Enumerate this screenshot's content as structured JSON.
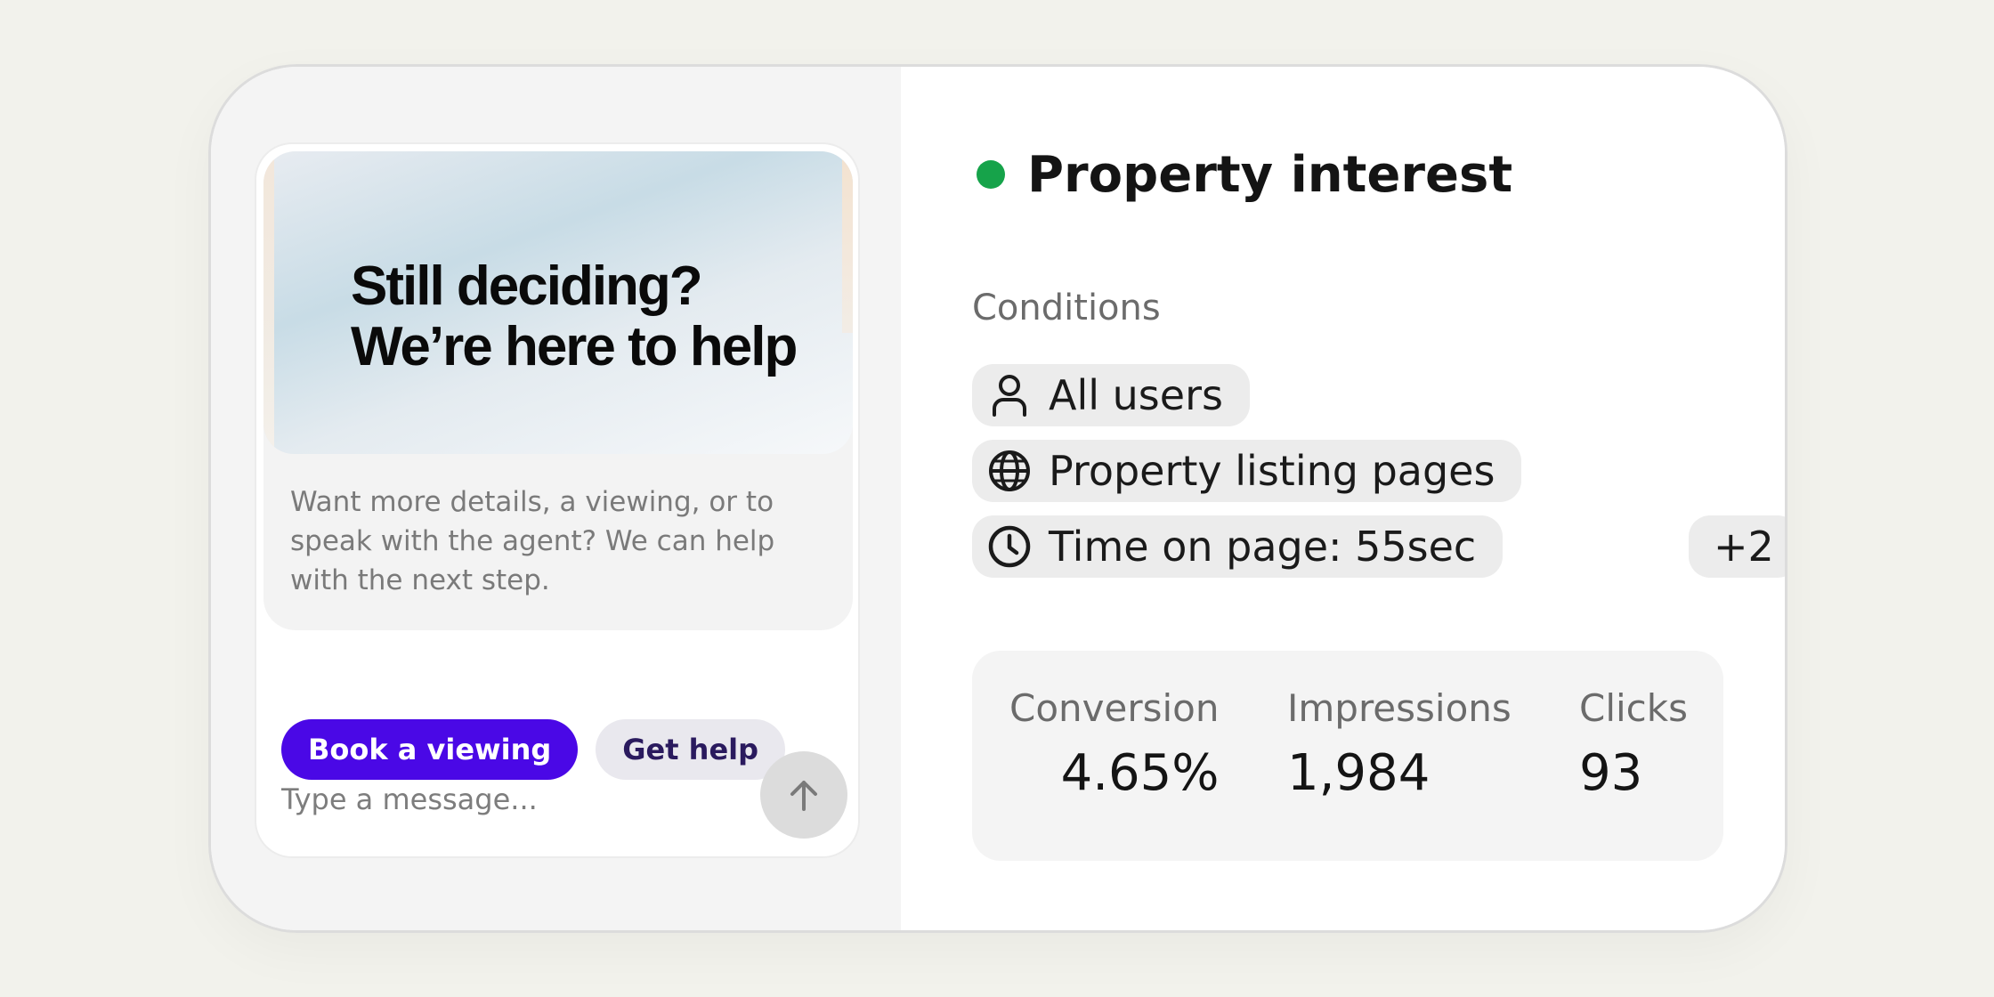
{
  "chat_widget": {
    "promo_title_line1": "Still deciding?",
    "promo_title_line2": "We’re here to help",
    "promo_text": "Want more details, a viewing, or to speak with the agent? We can help with the next step.",
    "primary_action": "Book a viewing",
    "secondary_action": "Get help",
    "message_placeholder": "Type a message...",
    "send_icon": "arrow-up-icon"
  },
  "rule": {
    "status_color": "#16a34a",
    "title": "Property interest",
    "menu_icon": "more-horizontal-icon",
    "conditions_label": "Conditions",
    "conditions": [
      {
        "icon": "user-icon",
        "label": "All users"
      },
      {
        "icon": "globe-icon",
        "label": "Property listing pages"
      },
      {
        "icon": "clock-icon",
        "label": "Time on page: 55sec"
      }
    ],
    "more_conditions": "+2"
  },
  "stats": [
    {
      "label": "Conversion",
      "value": "4.65%"
    },
    {
      "label": "Impressions",
      "value": "1,984"
    },
    {
      "label": "Clicks",
      "value": "93"
    }
  ],
  "colors": {
    "accent": "#4a08e6",
    "status_active": "#16a34a",
    "background": "#f2f2ec"
  }
}
